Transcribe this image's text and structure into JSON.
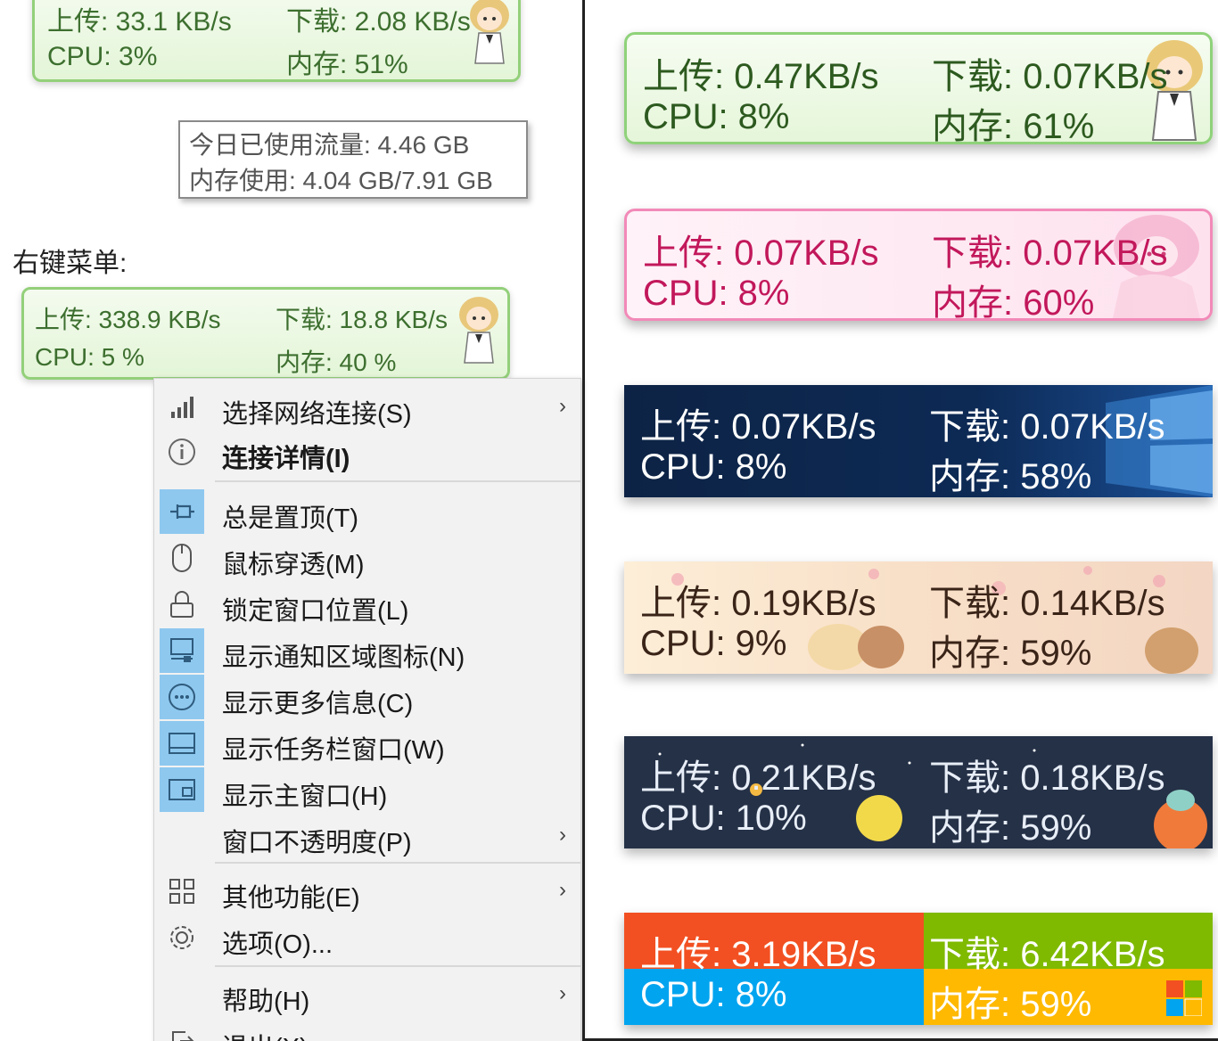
{
  "mini_widget_top": {
    "upload": "上传: 33.1 KB/s",
    "download": "下载: 2.08 KB/s",
    "cpu": "CPU: 3%",
    "memory": "内存: 51%"
  },
  "tooltip": {
    "line1": "今日已使用流量: 4.46 GB",
    "line2": "内存使用: 4.04 GB/7.91 GB"
  },
  "section_label": "右键菜单:",
  "mini_widget_menu": {
    "upload": "上传: 338.9 KB/s",
    "download": "下载: 18.8 KB/s",
    "cpu": "CPU: 5 %",
    "memory": "内存: 40 %"
  },
  "context_menu": {
    "items": [
      {
        "label": "选择网络连接(S)",
        "icon": "signal-bars-icon",
        "checked": false,
        "submenu": true
      },
      {
        "label": "连接详情(I)",
        "icon": "info-icon",
        "checked": false,
        "submenu": false,
        "bold": true
      },
      {
        "label": "总是置顶(T)",
        "icon": "pin-icon",
        "checked": true,
        "submenu": false
      },
      {
        "label": "鼠标穿透(M)",
        "icon": "mouse-icon",
        "checked": false,
        "submenu": false
      },
      {
        "label": "锁定窗口位置(L)",
        "icon": "lock-icon",
        "checked": false,
        "submenu": false
      },
      {
        "label": "显示通知区域图标(N)",
        "icon": "notification-area-icon",
        "checked": true,
        "submenu": false
      },
      {
        "label": "显示更多信息(C)",
        "icon": "more-info-icon",
        "checked": true,
        "submenu": false
      },
      {
        "label": "显示任务栏窗口(W)",
        "icon": "taskbar-window-icon",
        "checked": true,
        "submenu": false
      },
      {
        "label": "显示主窗口(H)",
        "icon": "main-window-icon",
        "checked": true,
        "submenu": false
      },
      {
        "label": "窗口不透明度(P)",
        "icon": "",
        "checked": false,
        "submenu": true
      },
      {
        "label": "其他功能(E)",
        "icon": "grid-icon",
        "checked": false,
        "submenu": true
      },
      {
        "label": "选项(O)...",
        "icon": "gear-icon",
        "checked": false,
        "submenu": false
      },
      {
        "label": "帮助(H)",
        "icon": "",
        "checked": false,
        "submenu": true
      },
      {
        "label": "退出(X)",
        "icon": "exit-icon",
        "checked": false,
        "submenu": false
      }
    ],
    "arrow": "›"
  },
  "skins": [
    {
      "id": "green",
      "upload": "上传: 0.47KB/s",
      "download": "下载: 0.07KB/s",
      "cpu": "CPU: 8%",
      "memory": "内存: 61%"
    },
    {
      "id": "pink",
      "upload": "上传: 0.07KB/s",
      "download": "下载: 0.07KB/s",
      "cpu": "CPU: 8%",
      "memory": "内存: 60%"
    },
    {
      "id": "windows",
      "upload": "上传: 0.07KB/s",
      "download": "下载: 0.07KB/s",
      "cpu": "CPU: 8%",
      "memory": "内存: 58%"
    },
    {
      "id": "sakura",
      "upload": "上传: 0.19KB/s",
      "download": "下载: 0.14KB/s",
      "cpu": "CPU: 9%",
      "memory": "内存: 59%"
    },
    {
      "id": "space",
      "upload": "上传: 0.21KB/s",
      "download": "下载: 0.18KB/s",
      "cpu": "CPU: 10%",
      "memory": "内存: 59%"
    },
    {
      "id": "metro",
      "upload": "上传: 3.19KB/s",
      "download": "下载: 6.42KB/s",
      "cpu": "CPU: 8%",
      "memory": "内存: 59%"
    }
  ],
  "colors": {
    "green_border": "#8fd27a",
    "pink_text": "#c2185b",
    "menu_check_bg": "#8ec8ef",
    "metro_upload": "#f25022",
    "metro_download": "#7fba00",
    "metro_cpu": "#00a4ef",
    "metro_memory": "#ffb900"
  }
}
